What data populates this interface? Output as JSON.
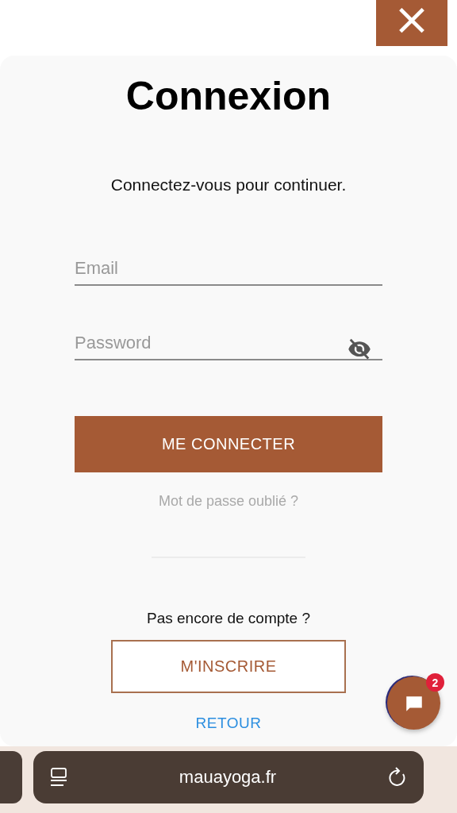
{
  "close_button": {
    "label": "×"
  },
  "title": "Connexion",
  "subtitle": "Connectez-vous pour continuer.",
  "fields": [
    {
      "kind": "text",
      "placeholder": "Email"
    },
    {
      "kind": "password",
      "placeholder": "Password",
      "reveal": false
    }
  ],
  "login_button": "ME CONNECTER",
  "forgot_link": "Mot de passe oublié ?",
  "signup_prompt": "Pas encore de compte ?",
  "signup_button": "M'INSCRIRE",
  "back_link": "RETOUR",
  "chat": {
    "badge": "2"
  },
  "browser": {
    "url": "mauayoga.fr"
  }
}
